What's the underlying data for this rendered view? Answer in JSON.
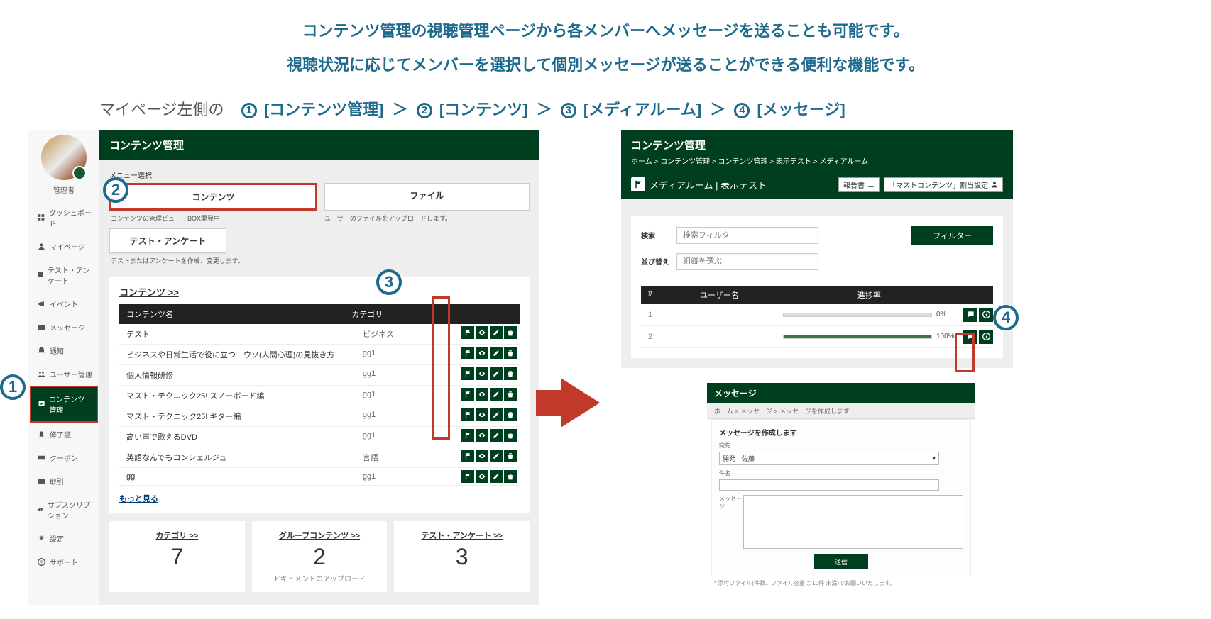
{
  "intro": {
    "line1": "コンテンツ管理の視聴管理ページから各メンバーへメッセージを送ることも可能です。",
    "line2": "視聴状況に応じてメンバーを選択して個別メッセージが送ることができる便利な機能です。"
  },
  "bc": {
    "prefix": "マイページ左側の",
    "p1": "[コンテンツ管理]",
    "p2": "[コンテンツ]",
    "p3": "[メディアルーム]",
    "p4": "[メッセージ]",
    "n1": "①",
    "n2": "②",
    "n3": "③",
    "n4": "④"
  },
  "sidebar": {
    "role": "管理者",
    "items": [
      {
        "label": "ダッシュボード"
      },
      {
        "label": "マイページ"
      },
      {
        "label": "テスト・アンケート"
      },
      {
        "label": "イベント"
      },
      {
        "label": "メッセージ"
      },
      {
        "label": "通知"
      },
      {
        "label": "ユーザー管理"
      },
      {
        "label": "コンテンツ管理"
      },
      {
        "label": "修了証"
      },
      {
        "label": "クーポン"
      },
      {
        "label": "取引"
      },
      {
        "label": "サブスクリプション"
      },
      {
        "label": "設定"
      },
      {
        "label": "サポート"
      }
    ]
  },
  "content": {
    "header": "コンテンツ管理",
    "menu_label": "メニュー選択",
    "menu": {
      "contents": "コンテンツ",
      "file": "ファイル",
      "contents_cap": "コンテンツの管理ビュー　BOX開発中",
      "file_cap": "ユーザーのファイルをアップロードします。",
      "test": "テスト・アンケート",
      "test_cap": "テストまたはアンケートを作成、変更します。"
    },
    "section_title": "コンテンツ >>",
    "cols": {
      "name": "コンテンツ名",
      "cat": "カテゴリ"
    },
    "rows": [
      {
        "name": "テスト",
        "cat": "ビジネス"
      },
      {
        "name": "ビジネスや日常生活で役に立つ　ウソ(人間心理)の見抜き方",
        "cat": "gg1"
      },
      {
        "name": "個人情報研修",
        "cat": "gg1"
      },
      {
        "name": "マスト・テクニック25! スノーボード編",
        "cat": "gg1"
      },
      {
        "name": "マスト・テクニック25! ギター編",
        "cat": "gg1"
      },
      {
        "name": "高い声で歌えるDVD",
        "cat": "gg1"
      },
      {
        "name": "英語なんでもコンシェルジュ",
        "cat": "言語"
      },
      {
        "name": "gg",
        "cat": "gg1"
      }
    ],
    "more": "もっと見る",
    "stats": {
      "cat": {
        "label": "カテゴリ >>",
        "val": "7"
      },
      "grp": {
        "label": "グループコンテンツ >>",
        "val": "2",
        "sub": "ドキュメントのアップロード"
      },
      "tst": {
        "label": "テスト・アンケート >>",
        "val": "3"
      }
    }
  },
  "right": {
    "header": "コンテンツ管理",
    "crumb": "ホーム  >  コンテンツ管理  >  コンテンツ管理  >  表示テスト  >  メディアルーム",
    "bar_title": "メディアルーム | 表示テスト",
    "btn_report": "報告書",
    "btn_assign": "「マストコンテンツ」割当設定",
    "filter": {
      "search_label": "検索",
      "search_ph": "検索フィルタ",
      "sort_label": "並び替え",
      "sort_ph": "組織を選ぶ",
      "btn": "フィルター"
    },
    "table": {
      "h_num": "#",
      "h_user": "ユーザー名",
      "h_prog": "進捗率",
      "rows": [
        {
          "num": "1",
          "pct": "0%",
          "fill": 0
        },
        {
          "num": "2",
          "pct": "100%",
          "fill": 100
        }
      ]
    }
  },
  "msg": {
    "header": "メッセージ",
    "crumb": "ホーム > メッセージ > メッセージを作成します",
    "sub": "メッセージを作成します",
    "to_label": "宛先",
    "to_val": "開発　佐藤",
    "subj_label": "件名",
    "body_label": "メッセージ",
    "send": "送信",
    "note": "* 添付ファイル(件数、ファイル容量は 10件 未満)でお願いいたします。"
  },
  "nums": {
    "n1": "1",
    "n2": "2",
    "n3": "3",
    "n4": "4"
  }
}
